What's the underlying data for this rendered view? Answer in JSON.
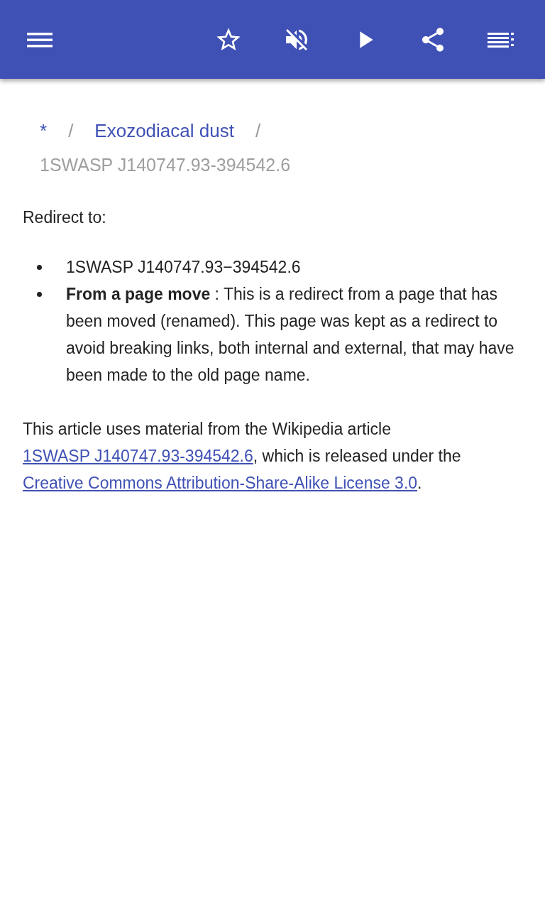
{
  "toolbar": {
    "buttons": [
      {
        "kind": "menu"
      },
      {
        "kind": "star"
      },
      {
        "kind": "mute"
      },
      {
        "kind": "play"
      },
      {
        "kind": "share"
      },
      {
        "kind": "contents"
      }
    ]
  },
  "breadcrumb": {
    "items": [
      {
        "label": "*"
      },
      {
        "label": "Exozodiacal dust"
      }
    ],
    "separator": "/",
    "current": "1SWASP J140747.93-394542.6"
  },
  "intro": "Redirect to:",
  "bullets": [
    "1SWASP J140747.93−394542.6",
    "**From a page move** : This is a redirect from a page that has been moved (renamed). This page was kept as a redirect to avoid breaking links, both internal and external, that may have been made to the old page name."
  ],
  "footer": [
    {
      "kind": "text",
      "text": "This article uses material from the Wikipedia article "
    },
    {
      "kind": "link",
      "text": "1SWASP J140747.93-394542.6"
    },
    {
      "kind": "text",
      "text": ", which is released under the "
    },
    {
      "kind": "link",
      "text": "Creative Commons Attribution-Share-Alike License 3.0"
    },
    {
      "kind": "text",
      "text": "."
    }
  ]
}
